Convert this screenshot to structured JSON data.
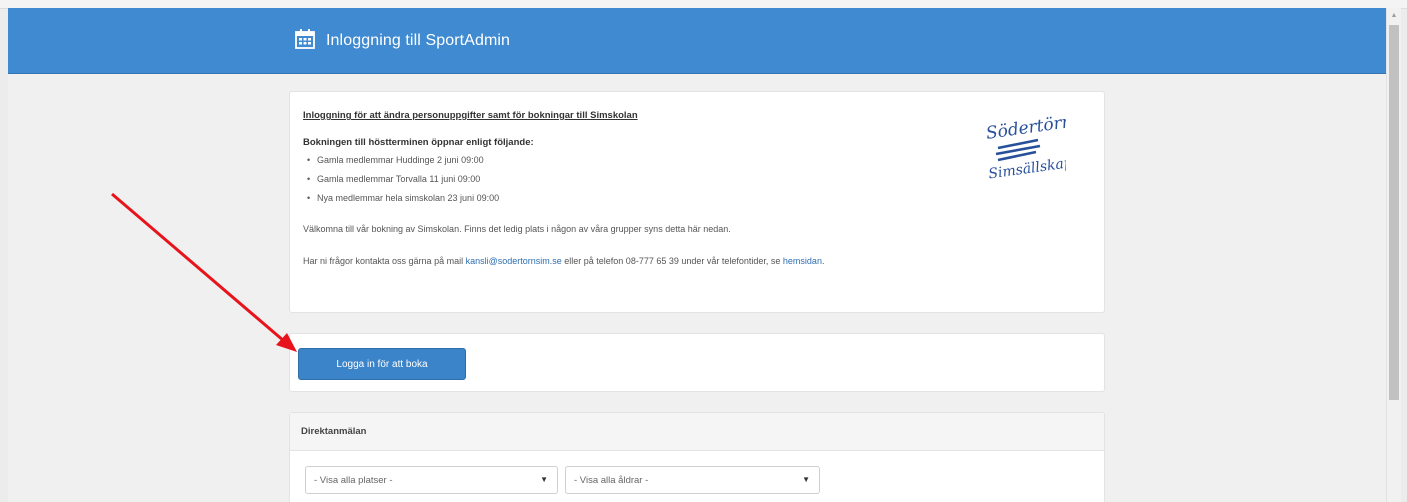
{
  "header": {
    "title": "Inloggning till SportAdmin",
    "icon": "calendar-icon",
    "background_color": "#3f8ad0"
  },
  "info": {
    "heading": "Inloggning för att ändra personuppgifter samt för bokningar till Simskolan",
    "subheading": "Bokningen till höstterminen öppnar enligt följande:",
    "schedule": [
      "Gamla medlemmar Huddinge 2 juni 09:00",
      "Gamla medlemmar Torvalla 11 juni 09:00",
      "Nya medlemmar hela simskolan 23 juni 09:00"
    ],
    "welcome": "Välkomna till vår bokning av Simskolan. Finns det ledig plats i någon av våra grupper syns detta här nedan.",
    "contact_prefix": "Har ni frågor kontakta oss gärna på mail ",
    "contact_email": "kansli@sodertornsim.se",
    "contact_middle": " eller på telefon 08-777 65 39 under vår telefontider, se ",
    "contact_link": "hemsidan",
    "contact_suffix": ".",
    "logo_text": [
      "Södertörns",
      "Simsällskap"
    ],
    "logo_color": "#27509b"
  },
  "login": {
    "button_label": "Logga in för att boka",
    "button_color": "#3c84c9"
  },
  "direct": {
    "title": "Direktanmälan",
    "places_select": "- Visa alla platser -",
    "ages_select": "- Visa alla åldrar -"
  },
  "annotation": {
    "arrow_color": "#e8141b"
  }
}
